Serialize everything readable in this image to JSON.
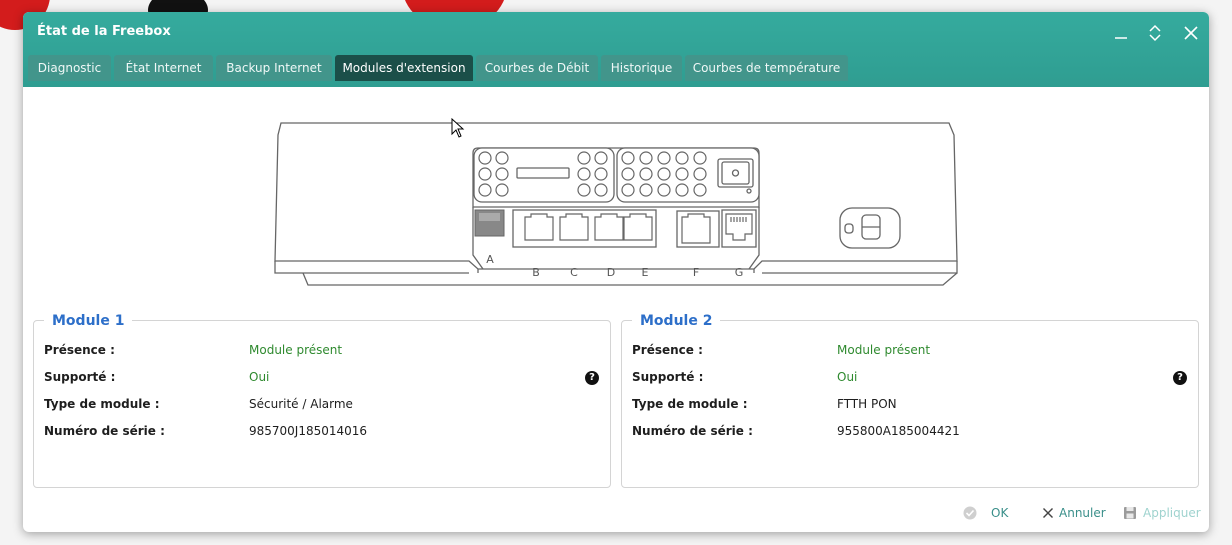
{
  "window": {
    "title": "État de la Freebox"
  },
  "tabs": [
    {
      "label": "Diagnostic"
    },
    {
      "label": "État Internet"
    },
    {
      "label": "Backup Internet"
    },
    {
      "label": "Modules d'extension"
    },
    {
      "label": "Courbes de Débit"
    },
    {
      "label": "Historique"
    },
    {
      "label": "Courbes de température"
    }
  ],
  "active_tab": "Modules d'extension",
  "ports": {
    "a": "A",
    "b": "B",
    "c": "C",
    "d": "D",
    "e": "E",
    "f": "F",
    "g": "G"
  },
  "labels": {
    "presence": "Présence :",
    "supported": "Supporté :",
    "type": "Type de module :",
    "serial": "Numéro de série :"
  },
  "modules": [
    {
      "title": "Module 1",
      "presence": "Module présent",
      "supported": "Oui",
      "type": "Sécurité / Alarme",
      "serial": "985700J185014016"
    },
    {
      "title": "Module 2",
      "presence": "Module présent",
      "supported": "Oui",
      "type": "FTTH PON",
      "serial": "955800A185004421"
    }
  ],
  "footer": {
    "ok": "OK",
    "cancel": "Annuler",
    "apply": "Appliquer"
  },
  "colors": {
    "titlebar": "#31a397",
    "tab": "#42958b",
    "tab_active": "#1b4f49",
    "legend": "#2d6fc9",
    "ok_value": "#2f8a2f",
    "footer_text": "#3a8f8a",
    "disabled_text": "#9fd3cf"
  }
}
